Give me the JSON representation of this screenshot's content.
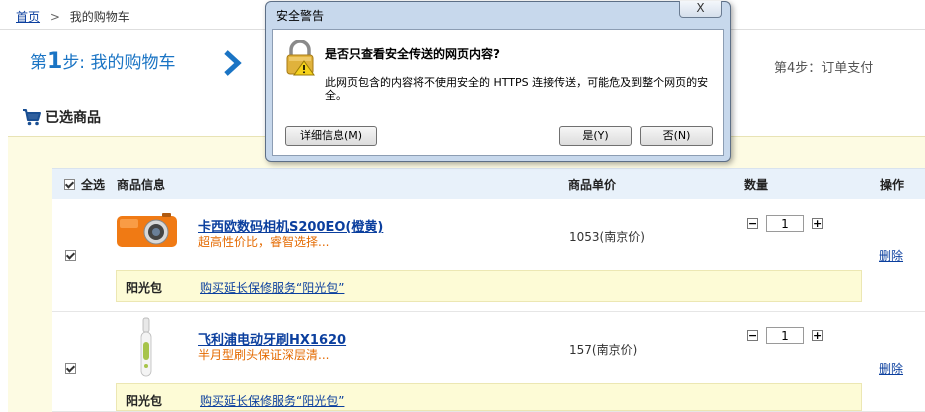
{
  "breadcrumb": {
    "home": "首页",
    "separator": ">",
    "current": "我的购物车"
  },
  "steps": {
    "step1_prefix": "第",
    "step1_num": "1",
    "step1_suffix": "步: 我的购物车",
    "step4": "第4步：订单支付"
  },
  "cart": {
    "title": "已选商品",
    "headers": {
      "select_all": "全选",
      "info": "商品信息",
      "price": "商品单价",
      "qty": "数量",
      "op": "操作"
    },
    "items": [
      {
        "name": "卡西欧数码相机S200EO(橙黄)",
        "desc": "超高性价比，睿智选择...",
        "price": "1053(南京价)",
        "qty": "1",
        "delete_label": "删除",
        "sunshine_label": "阳光包",
        "sunshine_link": "购买延长保修服务“阳光包”",
        "color": "#f07a14"
      },
      {
        "name": "飞利浦电动牙刷HX1620",
        "desc": "半月型刷头保证深层清...",
        "price": "157(南京价)",
        "qty": "1",
        "delete_label": "删除",
        "sunshine_label": "阳光包",
        "sunshine_link": "购买延长保修服务“阳光包”",
        "color": "#a7c44a"
      }
    ],
    "qty_minus": "−",
    "qty_plus": "+"
  },
  "dialog": {
    "title": "安全警告",
    "close": "X",
    "question": "是否只查看安全传送的网页内容?",
    "message": "此网页包含的内容将不使用安全的 HTTPS 连接传送，可能危及到整个网页的安全。",
    "details_button": "详细信息(M)",
    "yes_button": "是(Y)",
    "no_button": "否(N)"
  },
  "colors": {
    "accent": "#1a74c4",
    "link": "#0b3f9e",
    "desc": "#e46a00",
    "cart_bg": "#fdfbe3",
    "header_bg": "#e8f1fa"
  }
}
